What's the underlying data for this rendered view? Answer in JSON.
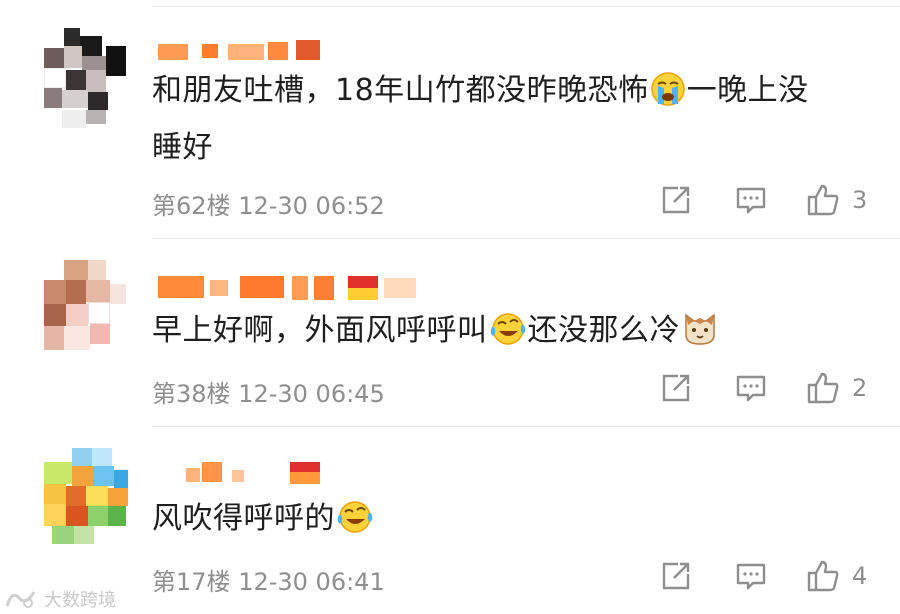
{
  "comments": [
    {
      "text_line1": "和朋友吐槽，18年山竹都没昨晚恐怖",
      "text_line1b": "一晚上没",
      "text_line2": "睡好",
      "floor": "第62楼",
      "time": "12-30 06:52",
      "likes": "3",
      "emoji1": "loudly-crying-face"
    },
    {
      "text_a": "早上好啊，外面风呼呼叫",
      "text_b": "还没那么冷",
      "floor": "第38楼",
      "time": "12-30 06:45",
      "likes": "2",
      "emoji1": "tears-of-joy-face",
      "emoji2": "cat-face"
    },
    {
      "text_a": "风吹得呼呼的",
      "floor": "第17楼",
      "time": "12-30 06:41",
      "likes": "4",
      "emoji1": "tears-of-joy-face"
    }
  ],
  "watermark": {
    "text": "大数跨境"
  },
  "colors": {
    "text": "#1f1f1f",
    "meta": "#8e8e8e",
    "username_blur": "#ff8a3d",
    "divider": "#e6e6e6"
  }
}
